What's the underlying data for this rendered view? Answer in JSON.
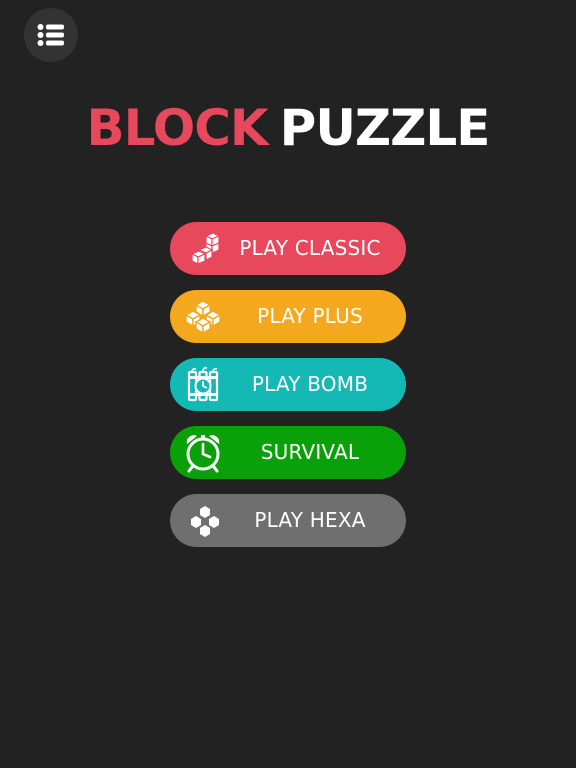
{
  "title": {
    "word1": "BLOCK",
    "word2": "PUZZLE",
    "word1_color": "#e8485c",
    "word2_color": "#ffffff"
  },
  "menu": {
    "icon": "list-menu-icon"
  },
  "modes": [
    {
      "label": "PLAY CLASSIC",
      "color": "#e8485c",
      "icon": "tetromino-blocks-icon"
    },
    {
      "label": "PLAY PLUS",
      "color": "#f3a81e",
      "icon": "cube-cluster-icon"
    },
    {
      "label": "PLAY BOMB",
      "color": "#14b8b4",
      "icon": "dynamite-bomb-icon"
    },
    {
      "label": "SURVIVAL",
      "color": "#0aa00a",
      "icon": "alarm-clock-icon"
    },
    {
      "label": "PLAY HEXA",
      "color": "#6f6f6f",
      "icon": "hexagons-icon"
    }
  ]
}
